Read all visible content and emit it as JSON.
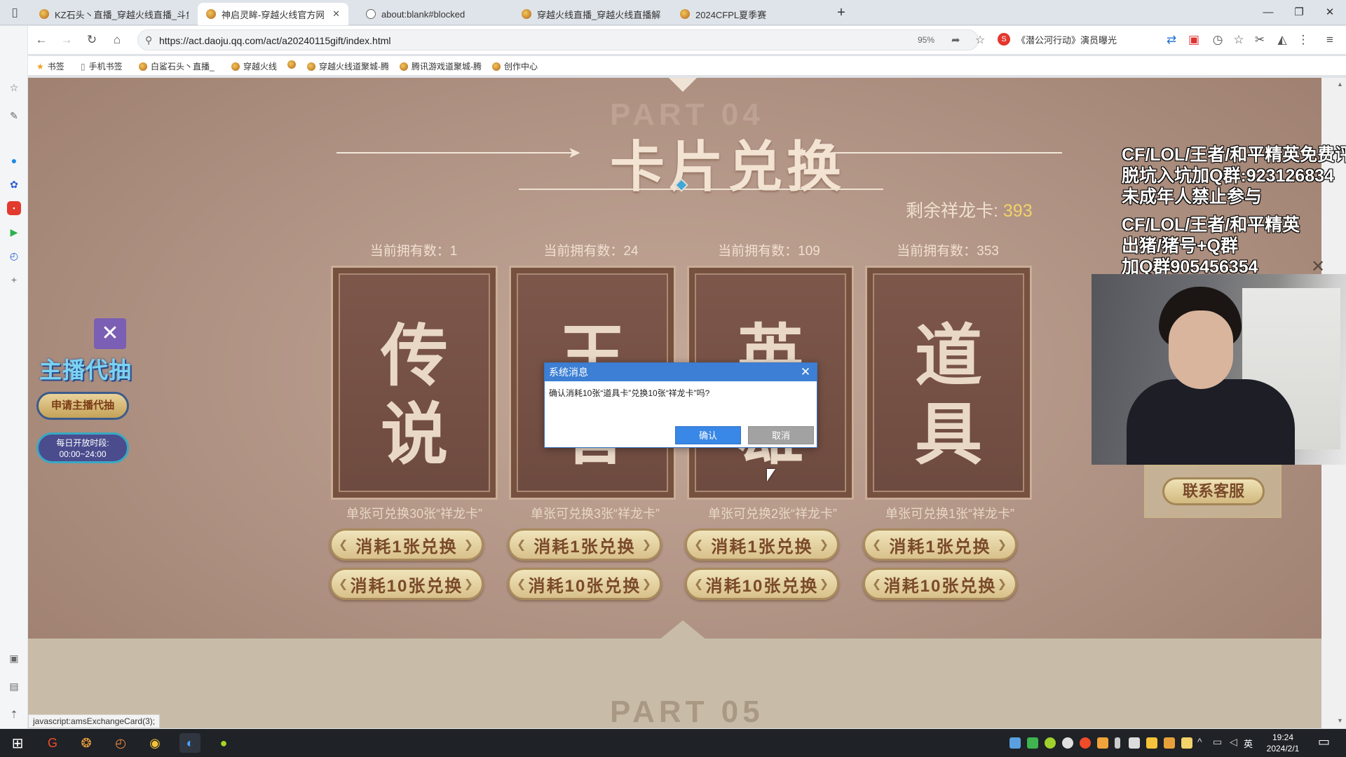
{
  "browser": {
    "tabs": [
      {
        "title": "KZ石头丶直播_穿越火线直播_斗鱼"
      },
      {
        "title": "神启灵眸-穿越火线官方网站-腾",
        "active": true
      },
      {
        "title": "about:blank#blocked"
      },
      {
        "title": "穿越火线直播_穿越火线直播解说"
      },
      {
        "title": "2024CFPL夏季赛"
      }
    ],
    "url": "https://act.daoju.qq.com/act/a20240115gift/index.html",
    "zoom": "95%",
    "news": "《潜公河行动》演员曝光",
    "bookmarks": [
      "书签",
      "手机书签",
      "白鲨石头丶直播_",
      "穿越火线",
      "穿越火线道聚城-腾",
      "腾讯游戏道聚城-腾",
      "创作中心"
    ]
  },
  "page": {
    "ghost_title": "PART 04",
    "title": "卡片兑换",
    "remaining_label": "剩余祥龙卡:",
    "remaining_value": "393",
    "cards": [
      {
        "owned": "当前拥有数：1",
        "char1": "传",
        "char2": "说",
        "rate": "单张可兑换30张“祥龙卡”"
      },
      {
        "owned": "当前拥有数：24",
        "char1": "王",
        "char2": "者",
        "rate": "单张可兑换3张“祥龙卡”"
      },
      {
        "owned": "当前拥有数：109",
        "char1": "英",
        "char2": "雄",
        "rate": "单张可兑换2张“祥龙卡”"
      },
      {
        "owned": "当前拥有数：353",
        "char1": "道",
        "char2": "具",
        "rate": "单张可兑换1张“祥龙卡”"
      }
    ],
    "btn_one": "消耗1张兑换",
    "btn_ten": "消耗10张兑换",
    "ghost_bottom": "PART 05",
    "contact": "联系客服"
  },
  "left_widget": {
    "close_icon": "✕",
    "title": "主播代抽",
    "apply": "申请主播代抽",
    "hours_label": "每日开放时段:",
    "hours": "00:00~24:00"
  },
  "dialog": {
    "title": "系统消息",
    "message": "确认消耗10张“道具卡”兑换10张“祥龙卡”吗?",
    "ok": "确认",
    "cancel": "取消"
  },
  "stream_overlay": {
    "lines": [
      "CF/LOL/王者/和平精英免费评估",
      "脱坑入坑加Q群:923126834",
      "未成年人禁止参与",
      "CF/LOL/王者/和平精英",
      "出猪/猪号+Q群",
      "加Q群905456354"
    ]
  },
  "status_bar": "javascript:amsExchangeCard(3);",
  "taskbar": {
    "time": "19:24",
    "date": "2024/2/1",
    "ime": "英"
  },
  "colors": {
    "accent": "#3c7fd4",
    "page_bg": "#ab8e7e",
    "card": "#7e574b",
    "gold": "#f2d26a"
  }
}
